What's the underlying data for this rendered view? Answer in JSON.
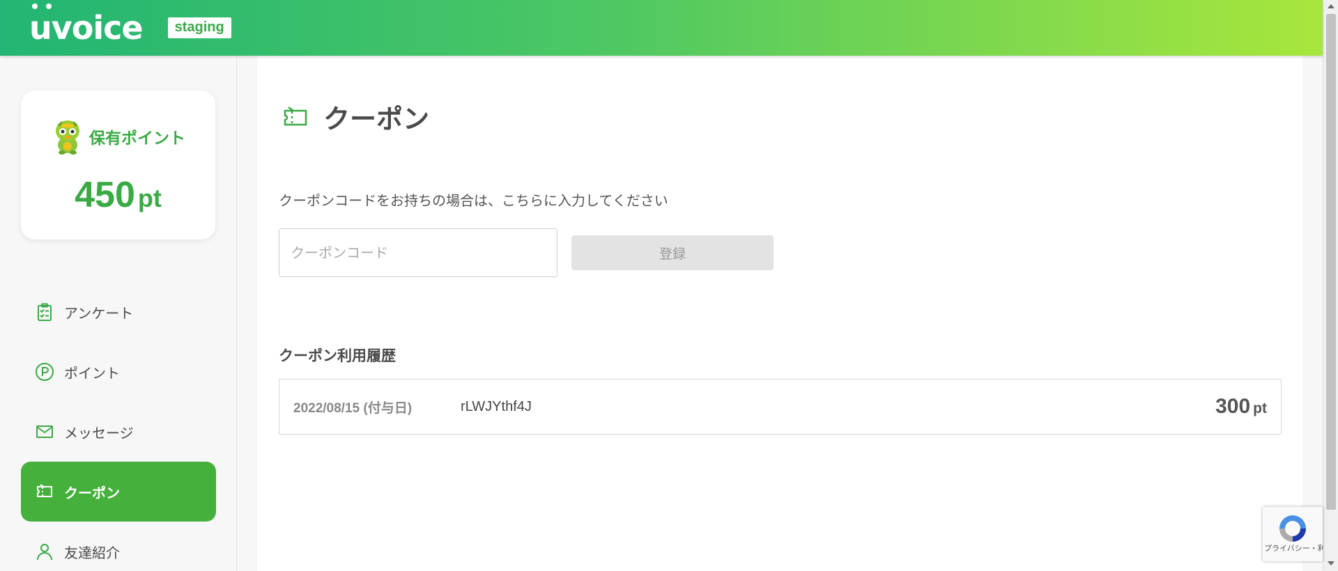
{
  "header": {
    "logo_text": "voice",
    "env_badge": "staging"
  },
  "sidebar": {
    "points_label": "保有ポイント",
    "points_value": "450",
    "points_unit": "pt",
    "items": [
      {
        "label": "アンケート",
        "icon": "clipboard-check-icon",
        "active": false
      },
      {
        "label": "ポイント",
        "icon": "point-circle-icon",
        "active": false
      },
      {
        "label": "メッセージ",
        "icon": "envelope-icon",
        "active": false
      },
      {
        "label": "クーポン",
        "icon": "ticket-icon",
        "active": true
      },
      {
        "label": "友達紹介",
        "icon": "person-icon",
        "active": false
      }
    ]
  },
  "main": {
    "title": "クーポン",
    "instruction": "クーポンコードをお持ちの場合は、こちらに入力してください",
    "coupon_input": {
      "placeholder": "クーポンコード",
      "value": ""
    },
    "register_label": "登録",
    "history_title": "クーポン利用履歴",
    "history": [
      {
        "date": "2022/08/15 (付与日)",
        "code": "rLWJYthf4J",
        "points": "300",
        "unit": "pt"
      }
    ]
  },
  "recaptcha": {
    "text": "プライバシー・利用規約"
  },
  "colors": {
    "brand_green": "#46b03c",
    "header_gradient_start": "#22b573",
    "header_gradient_end": "#a8e63c",
    "points_green": "#3aaa44"
  }
}
